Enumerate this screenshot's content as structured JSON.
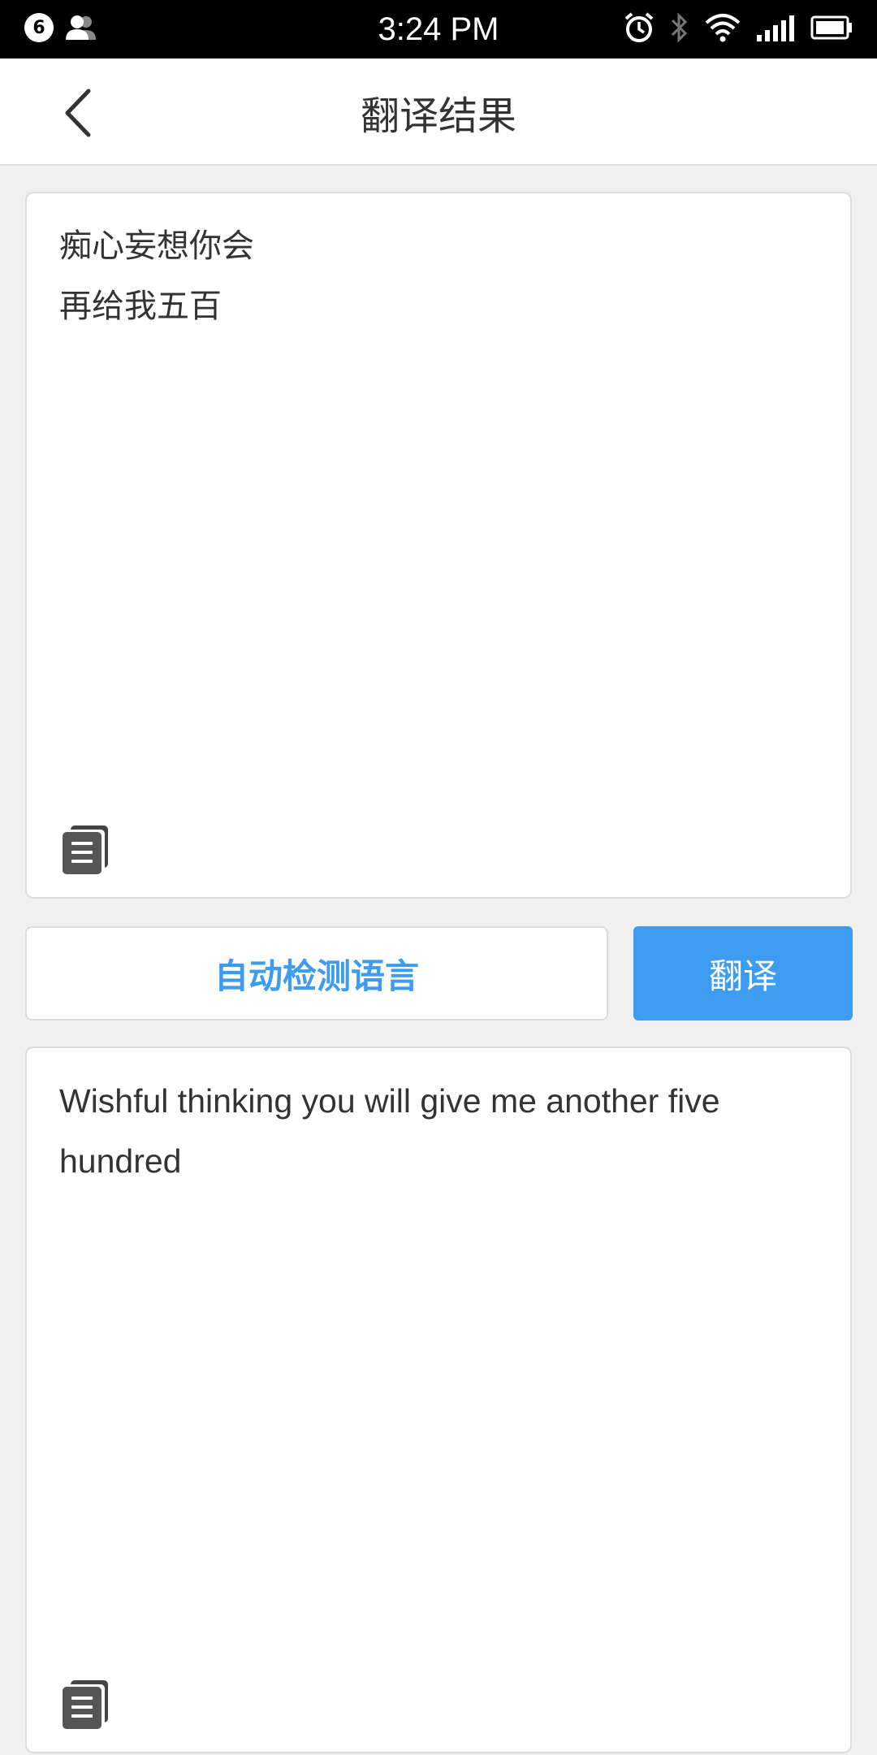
{
  "status_bar": {
    "notification_count": "6",
    "time": "3:24 PM",
    "icons": [
      "notification-count-icon",
      "contacts-icon",
      "alarm-icon",
      "bluetooth-icon",
      "wifi-icon",
      "signal-icon",
      "battery-icon"
    ]
  },
  "nav": {
    "title": "翻译结果",
    "back_icon": "back-chevron-icon"
  },
  "source": {
    "text": "痴心妄想你会\n再给我五百",
    "copy_icon": "copy-icon"
  },
  "controls": {
    "language_label": "自动检测语言",
    "translate_label": "翻译"
  },
  "result": {
    "text": "Wishful thinking you will give me another five hundred",
    "copy_icon": "copy-icon"
  },
  "colors": {
    "accent": "#3d9bf0",
    "background": "#f0f0f0",
    "text": "#333333"
  }
}
